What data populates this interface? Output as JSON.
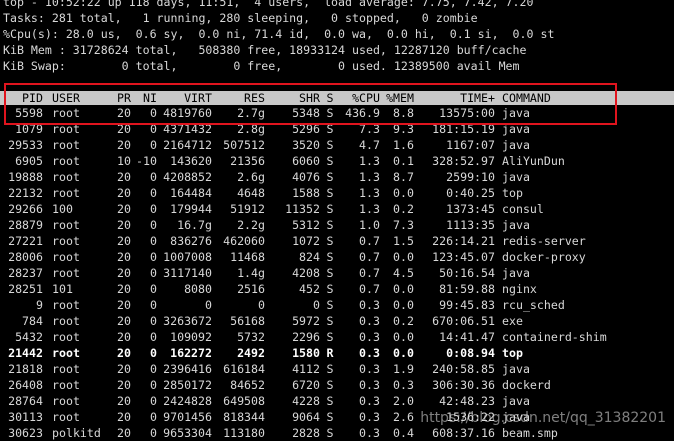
{
  "summary": {
    "line1": "top - 10:52:22 up 118 days, 11:51,  4 users,  load average: 7.75, 7.42, 7.20",
    "line2": "Tasks: 281 total,   1 running, 280 sleeping,   0 stopped,   0 zombie",
    "line3": "%Cpu(s): 28.0 us,  0.6 sy,  0.0 ni, 71.4 id,  0.0 wa,  0.0 hi,  0.1 si,  0.0 st",
    "line4": "KiB Mem : 31728624 total,   508380 free, 18933124 used, 12287120 buff/cache",
    "line5": "KiB Swap:        0 total,        0 free,        0 used. 12389500 avail Mem"
  },
  "columns": {
    "pid": "PID",
    "user": "USER",
    "pr": "PR",
    "ni": "NI",
    "virt": "VIRT",
    "res": "RES",
    "shr": "SHR",
    "s": "S",
    "cpu": "%CPU",
    "mem": "%MEM",
    "time": "TIME+",
    "command": "COMMAND"
  },
  "rows": [
    {
      "pid": "5598",
      "user": "root",
      "pr": "20",
      "ni": "0",
      "virt": "4819760",
      "res": "2.7g",
      "shr": "5348",
      "s": "S",
      "cpu": "436.9",
      "mem": "8.8",
      "time": "13575:00",
      "command": "java"
    },
    {
      "pid": "1079",
      "user": "root",
      "pr": "20",
      "ni": "0",
      "virt": "4371432",
      "res": "2.8g",
      "shr": "5296",
      "s": "S",
      "cpu": "7.3",
      "mem": "9.3",
      "time": "181:15.19",
      "command": "java"
    },
    {
      "pid": "29533",
      "user": "root",
      "pr": "20",
      "ni": "0",
      "virt": "2164712",
      "res": "507512",
      "shr": "3520",
      "s": "S",
      "cpu": "4.7",
      "mem": "1.6",
      "time": "1167:07",
      "command": "java"
    },
    {
      "pid": "6905",
      "user": "root",
      "pr": "10",
      "ni": "-10",
      "virt": "143620",
      "res": "21356",
      "shr": "6060",
      "s": "S",
      "cpu": "1.3",
      "mem": "0.1",
      "time": "328:52.97",
      "command": "AliYunDun"
    },
    {
      "pid": "19888",
      "user": "root",
      "pr": "20",
      "ni": "0",
      "virt": "4208852",
      "res": "2.6g",
      "shr": "4076",
      "s": "S",
      "cpu": "1.3",
      "mem": "8.7",
      "time": "2599:10",
      "command": "java"
    },
    {
      "pid": "22132",
      "user": "root",
      "pr": "20",
      "ni": "0",
      "virt": "164484",
      "res": "4648",
      "shr": "1588",
      "s": "S",
      "cpu": "1.3",
      "mem": "0.0",
      "time": "0:40.25",
      "command": "top"
    },
    {
      "pid": "29266",
      "user": "100",
      "pr": "20",
      "ni": "0",
      "virt": "179944",
      "res": "51912",
      "shr": "11352",
      "s": "S",
      "cpu": "1.3",
      "mem": "0.2",
      "time": "1373:45",
      "command": "consul"
    },
    {
      "pid": "28879",
      "user": "root",
      "pr": "20",
      "ni": "0",
      "virt": "16.7g",
      "res": "2.2g",
      "shr": "5312",
      "s": "S",
      "cpu": "1.0",
      "mem": "7.3",
      "time": "1113:35",
      "command": "java"
    },
    {
      "pid": "27221",
      "user": "root",
      "pr": "20",
      "ni": "0",
      "virt": "836276",
      "res": "462060",
      "shr": "1072",
      "s": "S",
      "cpu": "0.7",
      "mem": "1.5",
      "time": "226:14.21",
      "command": "redis-server"
    },
    {
      "pid": "28006",
      "user": "root",
      "pr": "20",
      "ni": "0",
      "virt": "1007008",
      "res": "11468",
      "shr": "824",
      "s": "S",
      "cpu": "0.7",
      "mem": "0.0",
      "time": "123:45.07",
      "command": "docker-proxy"
    },
    {
      "pid": "28237",
      "user": "root",
      "pr": "20",
      "ni": "0",
      "virt": "3117140",
      "res": "1.4g",
      "shr": "4208",
      "s": "S",
      "cpu": "0.7",
      "mem": "4.5",
      "time": "50:16.54",
      "command": "java"
    },
    {
      "pid": "28251",
      "user": "101",
      "pr": "20",
      "ni": "0",
      "virt": "8080",
      "res": "2516",
      "shr": "452",
      "s": "S",
      "cpu": "0.7",
      "mem": "0.0",
      "time": "81:59.88",
      "command": "nginx"
    },
    {
      "pid": "9",
      "user": "root",
      "pr": "20",
      "ni": "0",
      "virt": "0",
      "res": "0",
      "shr": "0",
      "s": "S",
      "cpu": "0.3",
      "mem": "0.0",
      "time": "99:45.83",
      "command": "rcu_sched"
    },
    {
      "pid": "784",
      "user": "root",
      "pr": "20",
      "ni": "0",
      "virt": "3263672",
      "res": "56168",
      "shr": "5972",
      "s": "S",
      "cpu": "0.3",
      "mem": "0.2",
      "time": "670:06.51",
      "command": "exe"
    },
    {
      "pid": "5432",
      "user": "root",
      "pr": "20",
      "ni": "0",
      "virt": "109092",
      "res": "5732",
      "shr": "2296",
      "s": "S",
      "cpu": "0.3",
      "mem": "0.0",
      "time": "14:41.47",
      "command": "containerd-shim"
    },
    {
      "pid": "21442",
      "user": "root",
      "pr": "20",
      "ni": "0",
      "virt": "162272",
      "res": "2492",
      "shr": "1580",
      "s": "R",
      "cpu": "0.3",
      "mem": "0.0",
      "time": "0:08.94",
      "command": "top",
      "bold": true
    },
    {
      "pid": "21818",
      "user": "root",
      "pr": "20",
      "ni": "0",
      "virt": "2396416",
      "res": "616184",
      "shr": "4112",
      "s": "S",
      "cpu": "0.3",
      "mem": "1.9",
      "time": "240:58.85",
      "command": "java"
    },
    {
      "pid": "26408",
      "user": "root",
      "pr": "20",
      "ni": "0",
      "virt": "2850172",
      "res": "84652",
      "shr": "6720",
      "s": "S",
      "cpu": "0.3",
      "mem": "0.3",
      "time": "306:30.36",
      "command": "dockerd"
    },
    {
      "pid": "28764",
      "user": "root",
      "pr": "20",
      "ni": "0",
      "virt": "2424828",
      "res": "649508",
      "shr": "4228",
      "s": "S",
      "cpu": "0.3",
      "mem": "2.0",
      "time": "42:48.23",
      "command": "java"
    },
    {
      "pid": "30113",
      "user": "root",
      "pr": "20",
      "ni": "0",
      "virt": "9701456",
      "res": "818344",
      "shr": "9064",
      "s": "S",
      "cpu": "0.3",
      "mem": "2.6",
      "time": "1536:22",
      "command": "java"
    },
    {
      "pid": "30623",
      "user": "polkitd",
      "pr": "20",
      "ni": "0",
      "virt": "9653304",
      "res": "113180",
      "shr": "2828",
      "s": "S",
      "cpu": "0.3",
      "mem": "0.4",
      "time": "608:37.16",
      "command": "beam.smp"
    }
  ],
  "watermark": "https://blog.csdn.net/qq_31382201",
  "colors": {
    "background": "#000000",
    "text": "#d8d8d8",
    "header_bg": "#c8c8c8",
    "highlight_border": "#e0141e"
  }
}
